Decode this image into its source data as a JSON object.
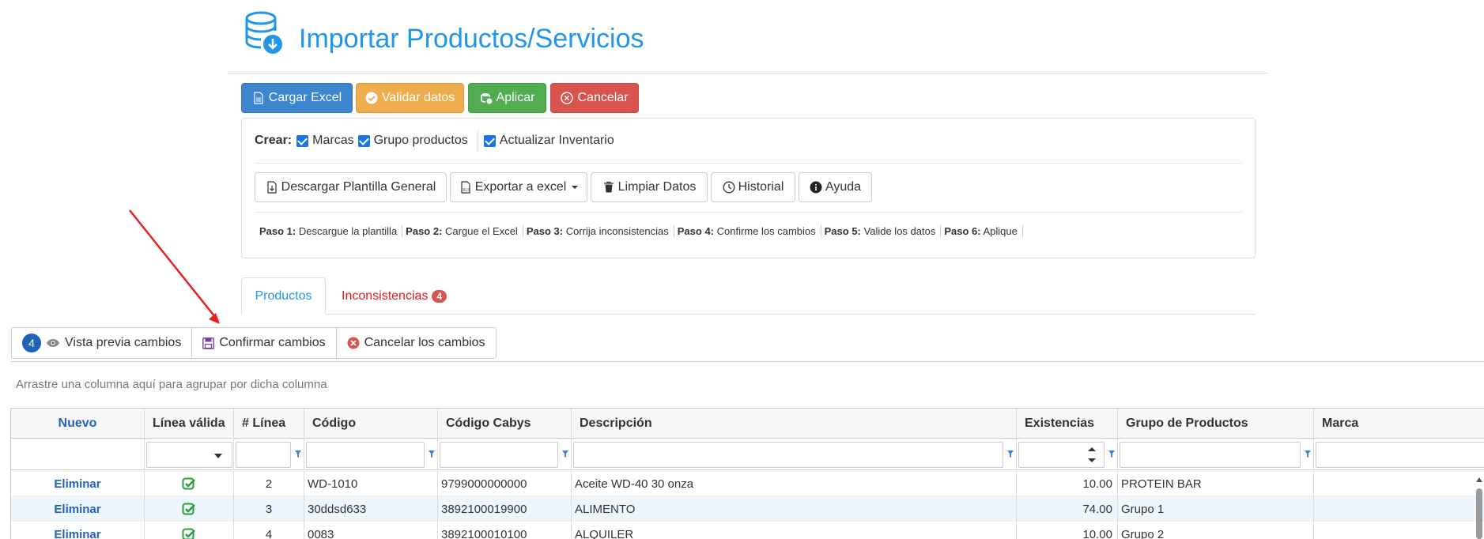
{
  "header": {
    "title": "Importar Productos/Servicios",
    "icon": "database-download-icon"
  },
  "toolbar": {
    "cargar_label": "Cargar Excel",
    "validar_label": "Validar datos",
    "aplicar_label": "Aplicar",
    "cancelar_label": "Cancelar"
  },
  "crear": {
    "label": "Crear:",
    "options": [
      {
        "label": "Marcas",
        "checked": true
      },
      {
        "label": "Grupo productos",
        "checked": true
      },
      {
        "label": "Actualizar Inventario",
        "checked": true
      }
    ]
  },
  "actions": {
    "descargar": "Descargar Plantilla General",
    "exportar": "Exportar a excel",
    "limpiar": "Limpiar Datos",
    "historial": "Historial",
    "ayuda": "Ayuda"
  },
  "pasos": [
    {
      "label": "Paso 1:",
      "text": "Descargue la plantilla"
    },
    {
      "label": "Paso 2:",
      "text": "Cargue el Excel"
    },
    {
      "label": "Paso 3:",
      "text": "Corrija inconsistencias"
    },
    {
      "label": "Paso 4:",
      "text": "Confirme los cambios"
    },
    {
      "label": "Paso 5:",
      "text": "Valide los datos"
    },
    {
      "label": "Paso 6:",
      "text": "Aplique"
    }
  ],
  "tabs": {
    "productos": "Productos",
    "inconsistencias": "Inconsistencias",
    "inconsistencias_count": "4"
  },
  "grid_toolbar": {
    "preview_count": "4",
    "preview_label": "Vista previa cambios",
    "confirmar_label": "Confirmar cambios",
    "cancelar_label": "Cancelar los cambios"
  },
  "group_panel": "Arrastre una columna aquí para agrupar por dicha columna",
  "grid": {
    "nuevo_label": "Nuevo",
    "columns": [
      "Línea válida",
      "# Línea",
      "Código",
      "Código Cabys",
      "Descripción",
      "Existencias",
      "Grupo de Productos",
      "Marca"
    ],
    "rows": [
      {
        "action": "Eliminar",
        "valid": true,
        "linea": "2",
        "codigo": "WD-1010",
        "cabys": "9799000000000",
        "descripcion": "Aceite WD-40 30 onza",
        "existencias": "10.00",
        "grupo": "PROTEIN BAR",
        "marca": ""
      },
      {
        "action": "Eliminar",
        "valid": true,
        "linea": "3",
        "codigo": "30ddsd633",
        "cabys": "3892100019900",
        "descripcion": "ALIMENTO",
        "existencias": "74.00",
        "grupo": "Grupo 1",
        "marca": ""
      },
      {
        "action": "Eliminar",
        "valid": true,
        "linea": "4",
        "codigo": "0083",
        "cabys": "3892100010100",
        "descripcion": "ALQUILER",
        "existencias": "10.00",
        "grupo": "Grupo 2",
        "marca": ""
      }
    ]
  },
  "colors": {
    "primary": "#3b86cf",
    "warning": "#f0ad4e",
    "success": "#52ac52",
    "danger": "#d9534f",
    "accent_title": "#2196e8",
    "link": "#1e63b5"
  }
}
